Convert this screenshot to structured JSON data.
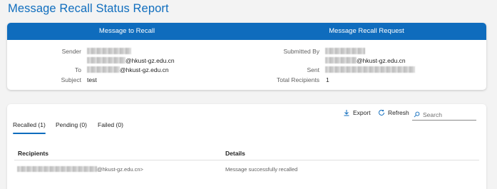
{
  "page": {
    "title": "Message Recall Status Report"
  },
  "summary": {
    "left_header": "Message to Recall",
    "right_header": "Message Recall Request",
    "sender_label": "Sender",
    "sender_domain": "@hkust-gz.edu.cn",
    "to_label": "To",
    "to_domain": "@hkust-gz.edu.cn",
    "subject_label": "Subject",
    "subject_value": "test",
    "submitted_by_label": "Submitted By",
    "submitted_by_domain": "@hkust-gz.edu.cn",
    "sent_label": "Sent",
    "total_recipients_label": "Total Recipients",
    "total_recipients_value": "1"
  },
  "toolbar": {
    "export_label": "Export",
    "refresh_label": "Refresh",
    "search_placeholder": "Search"
  },
  "tabs": [
    {
      "label": "Recalled (1)",
      "active": true
    },
    {
      "label": "Pending (0)",
      "active": false
    },
    {
      "label": "Failed (0)",
      "active": false
    }
  ],
  "table": {
    "columns": [
      "Recipients",
      "Details"
    ],
    "rows": [
      {
        "recipient_domain": "@hkust-gz.edu.cn>",
        "details": "Message successfully recalled"
      }
    ]
  },
  "colors": {
    "accent": "#0f6cbd",
    "title": "#106ebe"
  }
}
